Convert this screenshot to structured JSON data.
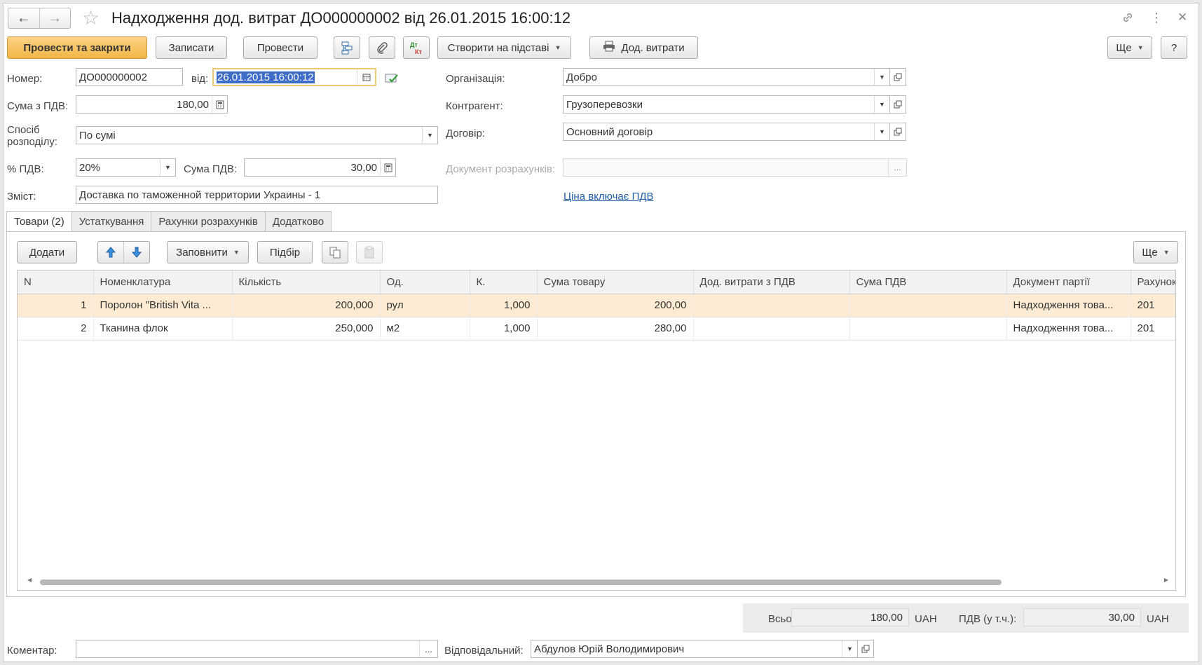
{
  "window": {
    "title": "Надходження дод. витрат ДО000000002 від 26.01.2015 16:00:12"
  },
  "toolbar": {
    "post_close": "Провести та закрити",
    "save": "Записати",
    "post": "Провести",
    "create_based": "Створити на підставі",
    "print_extra": "Дод. витрати",
    "more": "Ще",
    "help": "?"
  },
  "form": {
    "number_label": "Номер:",
    "number_value": "ДО000000002",
    "date_label": "від:",
    "date_value": "26.01.2015 16:00:12",
    "sum_vat_label": "Сума з ПДВ:",
    "sum_vat_value": "180,00",
    "distribution_label_1": "Спосіб",
    "distribution_label_2": "розподілу:",
    "distribution_value": "По сумі",
    "vat_pct_label": "% ПДВ:",
    "vat_pct_value": "20%",
    "vat_sum_label": "Сума ПДВ:",
    "vat_sum_value": "30,00",
    "content_label": "Зміст:",
    "content_value": "Доставка по таможенной территории Украины - 1",
    "org_label": "Організація:",
    "org_value": "Добро",
    "contractor_label": "Контрагент:",
    "contractor_value": "Грузоперевозки",
    "contract_label": "Договір:",
    "contract_value": "Основний договір",
    "settlement_doc_label": "Документ розрахунків:",
    "settlement_doc_value": "",
    "price_vat_link": "Ціна включає ПДВ"
  },
  "tabs": [
    {
      "label": "Товари (2)"
    },
    {
      "label": "Устаткування"
    },
    {
      "label": "Рахунки розрахунків"
    },
    {
      "label": "Додатково"
    }
  ],
  "table_toolbar": {
    "add": "Додати",
    "fill": "Заповнити",
    "pick": "Підбір",
    "more": "Ще"
  },
  "table": {
    "columns": [
      "N",
      "Номенклатура",
      "Кількість",
      "Од.",
      "К.",
      "Сума товару",
      "Дод. витрати з ПДВ",
      "Сума ПДВ",
      "Документ партії",
      "Рахунок"
    ],
    "rows": [
      [
        "1",
        "Поролон \"British Vita ...",
        "200,000",
        "рул",
        "1,000",
        "200,00",
        "",
        "",
        "Надходження това...",
        "201"
      ],
      [
        "2",
        "Тканина флок",
        "250,000",
        "м2",
        "1,000",
        "280,00",
        "",
        "",
        "Надходження това...",
        "201"
      ]
    ]
  },
  "totals": {
    "total_label": "Всього:",
    "total_value": "180,00",
    "currency": "UAH",
    "vat_label": "ПДВ (у т.ч.):",
    "vat_value": "30,00",
    "vat_currency": "UAH"
  },
  "footer": {
    "comment_label": "Коментар:",
    "comment_value": "",
    "responsible_label": "Відповідальний:",
    "responsible_value": "Абдулов Юрій Володимирович"
  },
  "colors": {
    "primary_button": "#f2b545",
    "selected_row": "#fdebd3",
    "link": "#1f5ea8"
  }
}
